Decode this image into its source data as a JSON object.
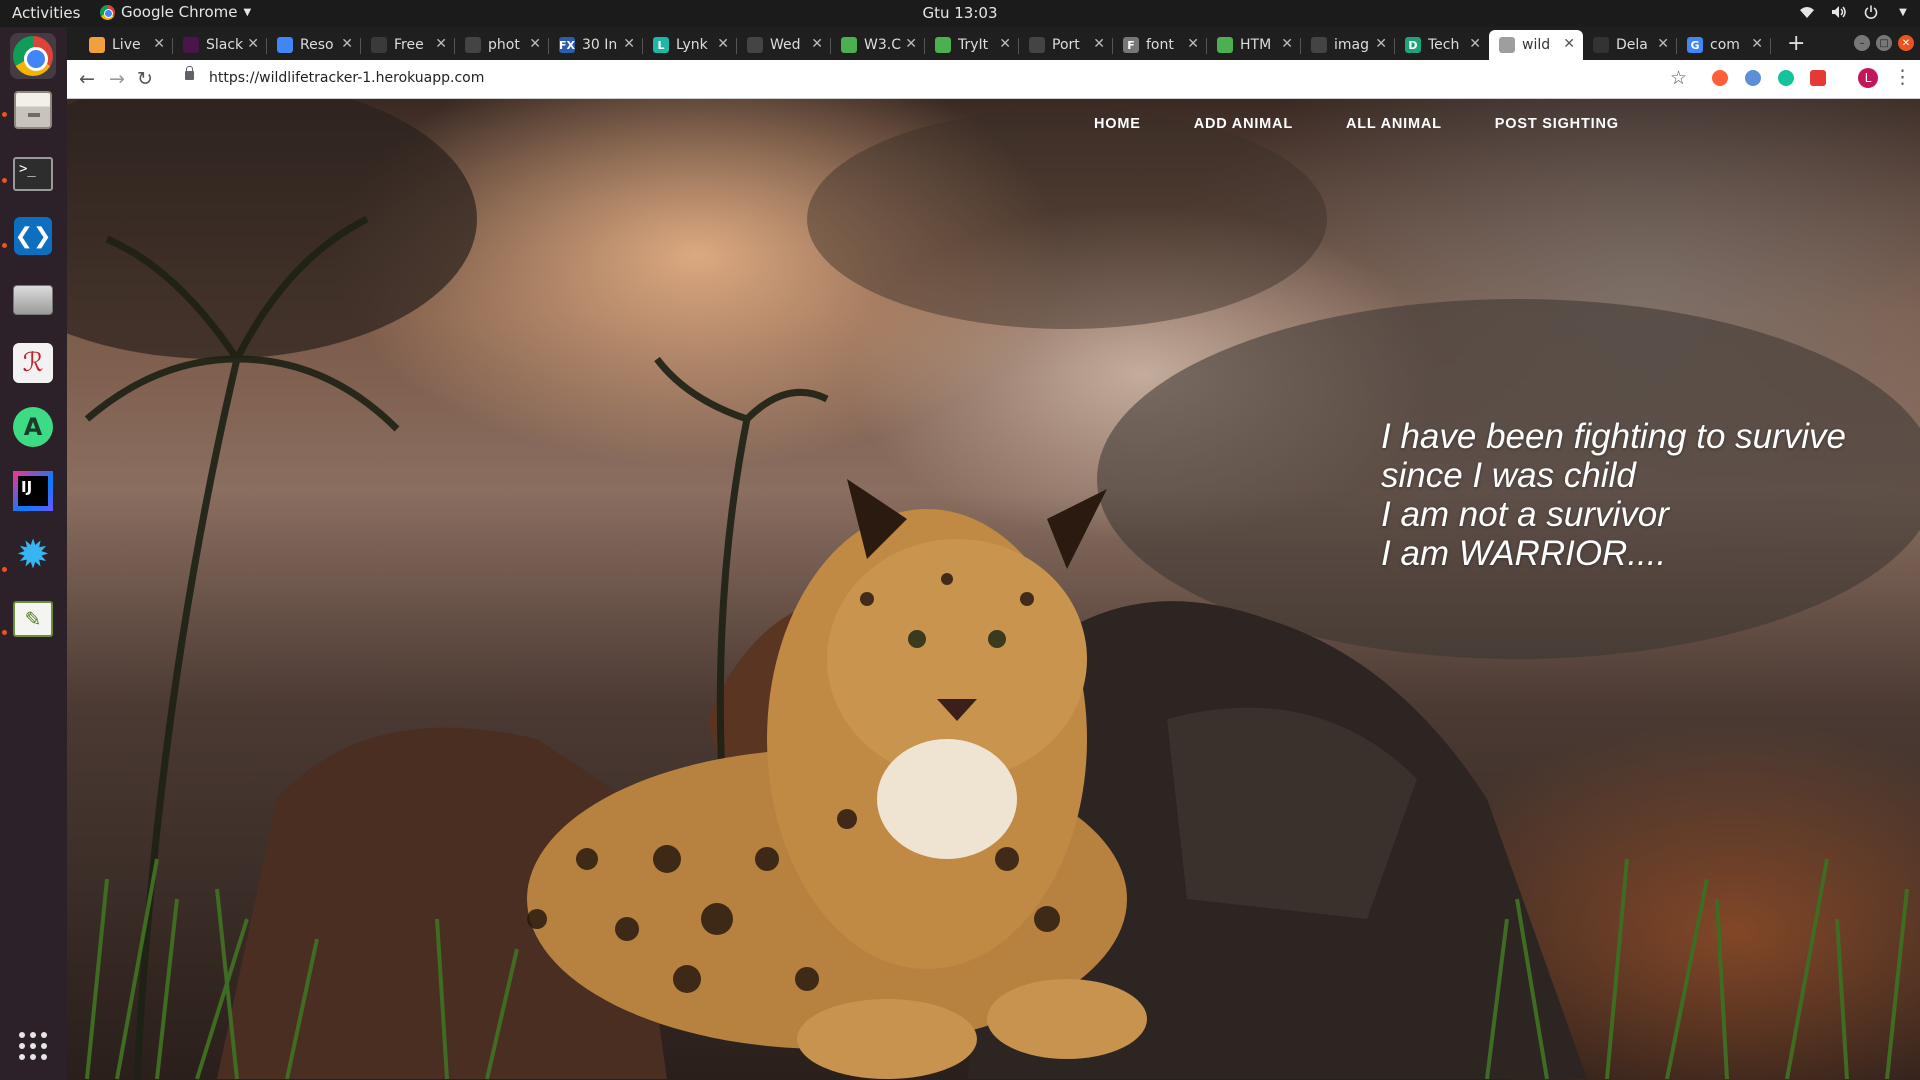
{
  "topbar": {
    "activities": "Activities",
    "app_name": "Google Chrome",
    "clock": "Gtu 13:03"
  },
  "dock": {
    "items": [
      {
        "name": "Google Chrome",
        "icon": "chrome-icon"
      },
      {
        "name": "Files",
        "icon": "files-icon"
      },
      {
        "name": "Terminal",
        "icon": "terminal-icon"
      },
      {
        "name": "Visual Studio Code",
        "icon": "vscode-icon"
      },
      {
        "name": "Printers",
        "icon": "printer-icon"
      },
      {
        "name": "Remmina",
        "icon": "remmina-icon"
      },
      {
        "name": "Android Studio",
        "icon": "android-studio-icon"
      },
      {
        "name": "IntelliJ IDEA",
        "icon": "intellij-icon"
      },
      {
        "name": "Settings",
        "icon": "gear-icon"
      },
      {
        "name": "Drawing",
        "icon": "drawing-icon"
      }
    ],
    "show_apps_icon": "app-grid-icon"
  },
  "tabs": [
    {
      "title": "Live",
      "favicon_color": "#f2a03d"
    },
    {
      "title": "Slack",
      "favicon_color": "#4a154b"
    },
    {
      "title": "Reso",
      "favicon_color": "#4285f4"
    },
    {
      "title": "Free",
      "favicon_color": "#3a3a3a"
    },
    {
      "title": "phot",
      "favicon_color": "#444444"
    },
    {
      "title": "30 In",
      "favicon_color": "#2a5db0",
      "favicon_text": "FX"
    },
    {
      "title": "Lynk",
      "favicon_color": "#1fb6a8",
      "favicon_text": "L"
    },
    {
      "title": "Wed",
      "favicon_color": "#444444"
    },
    {
      "title": "W3.C",
      "favicon_color": "#4caf50"
    },
    {
      "title": "TryIt",
      "favicon_color": "#4caf50"
    },
    {
      "title": "Port",
      "favicon_color": "#444444"
    },
    {
      "title": "font",
      "favicon_color": "#777777",
      "favicon_text": "F"
    },
    {
      "title": "HTM",
      "favicon_color": "#4caf50"
    },
    {
      "title": "imag",
      "favicon_color": "#444444"
    },
    {
      "title": "Tech",
      "favicon_color": "#1fa37a",
      "favicon_text": "D"
    },
    {
      "title": "wild",
      "favicon_color": "#9e9e9e",
      "active": true
    },
    {
      "title": "Dela",
      "favicon_color": "#333333"
    },
    {
      "title": "com",
      "favicon_color": "#4285f4",
      "favicon_text": "G"
    }
  ],
  "toolbar": {
    "url": "https://wildlifetracker-1.herokuapp.com",
    "profile_initial": "L"
  },
  "site": {
    "nav": [
      "HOME",
      "ADD ANIMAL",
      "ALL ANIMAL",
      "POST SIGHTING"
    ],
    "quote_lines": [
      "I have been fighting to survive",
      "since I was child",
      "I am not a survivor",
      "I am WARRIOR...."
    ]
  },
  "colors": {
    "dock_bg": "#2c2029",
    "topbar_bg": "#1b1b1b",
    "tabstrip_bg": "#1f1f1f",
    "ubuntu_accent": "#e95420"
  }
}
